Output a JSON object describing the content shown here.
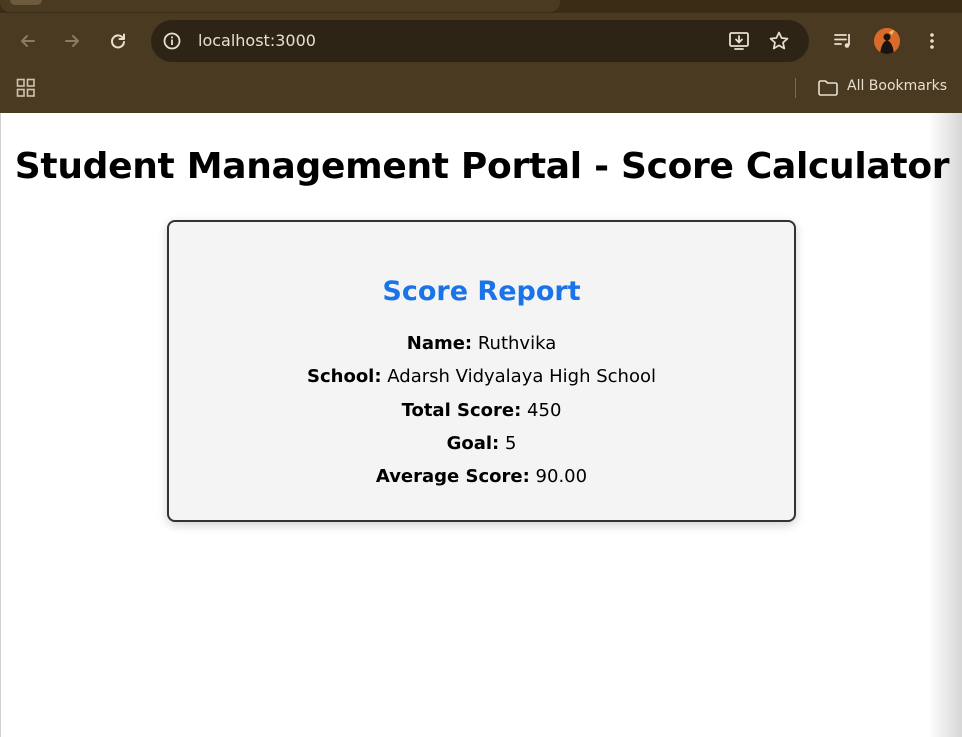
{
  "browser": {
    "url": "localhost:3000",
    "bookmarks_label": "All Bookmarks",
    "icons": [
      "back-icon",
      "forward-icon",
      "reload-icon",
      "site-info-icon",
      "install-app-icon",
      "bookmark-star-icon",
      "media-control-icon",
      "profile-avatar",
      "menu-icon",
      "apps-grid-icon",
      "folder-icon"
    ]
  },
  "page": {
    "title": "Student Management Portal - Score Calculator",
    "card": {
      "heading": "Score Report",
      "heading_color": "#1a73e8",
      "rows": [
        {
          "label": "Name:",
          "value": "Ruthvika"
        },
        {
          "label": "School:",
          "value": "Adarsh Vidyalaya High School"
        },
        {
          "label": "Total Score:",
          "value": "450"
        },
        {
          "label": "Goal:",
          "value": "5"
        },
        {
          "label": "Average Score:",
          "value": "90.00"
        }
      ]
    }
  },
  "colors": {
    "chrome_bg": "#4a3a21",
    "omnibox_bg": "#2e2415",
    "card_bg": "#f4f4f4",
    "card_border": "#333333"
  }
}
